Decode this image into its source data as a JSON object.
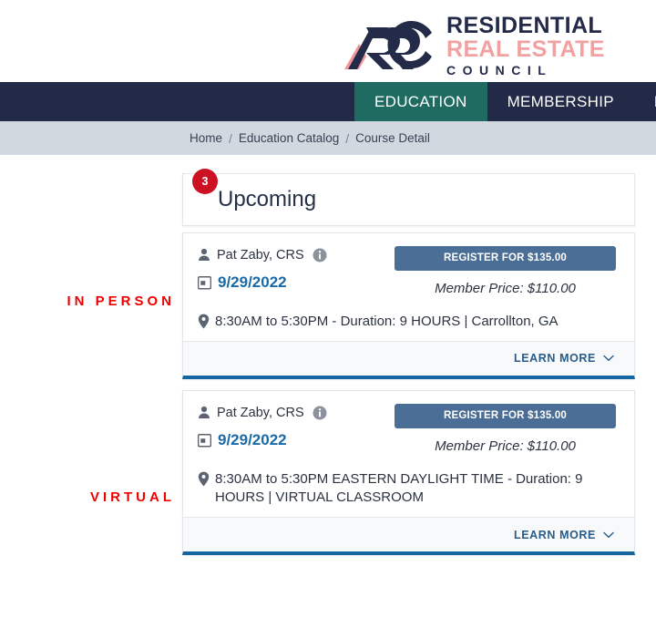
{
  "header": {
    "logo": {
      "mark_alt": "rrc-logo-mark",
      "line1": "RESIDENTIAL",
      "line2": "REAL ESTATE",
      "line3": "COUNCIL"
    }
  },
  "nav": {
    "items": [
      {
        "label": "EDUCATION",
        "active": true
      },
      {
        "label": "MEMBERSHIP",
        "active": false
      },
      {
        "label": "E",
        "active": false
      }
    ]
  },
  "breadcrumb": {
    "items": [
      "Home",
      "Education Catalog",
      "Course Detail"
    ],
    "separator": "/"
  },
  "side_labels": {
    "in_person": "IN PERSON",
    "virtual": "VIRTUAL"
  },
  "upcoming": {
    "title": "Upcoming",
    "count": "3"
  },
  "courses": [
    {
      "delivery": "IN PERSON",
      "instructor": "Pat Zaby, CRS",
      "date": "9/29/2022",
      "location": "8:30AM to 5:30PM - Duration: 9 HOURS | Carrollton, GA",
      "register_label": "REGISTER FOR $135.00",
      "member_price": "Member Price: $110.00",
      "learn_more": "LEARN MORE"
    },
    {
      "delivery": "VIRTUAL",
      "instructor": "Pat Zaby, CRS",
      "date": "9/29/2022",
      "location": "8:30AM to 5:30PM EASTERN DAYLIGHT TIME - Duration: 9 HOURS | VIRTUAL CLASSROOM",
      "register_label": "REGISTER FOR $135.00",
      "member_price": "Member Price: $110.00",
      "learn_more": "LEARN MORE"
    }
  ],
  "colors": {
    "nav_bg": "#232a47",
    "nav_active": "#1f6b61",
    "breadcrumb_bg": "#d2d8e0",
    "badge_red": "#cc1122",
    "label_red": "#ee0000",
    "date_blue": "#1a6aa8",
    "register_blue": "#4a6e96",
    "card_accent": "#1565a0",
    "logo_navy": "#242b48",
    "logo_pink": "#f2a0a0"
  },
  "icons": {
    "person": "person-icon",
    "info": "info-icon",
    "calendar": "calendar-icon",
    "pin": "map-pin-icon",
    "chevron": "chevron-down-icon"
  }
}
